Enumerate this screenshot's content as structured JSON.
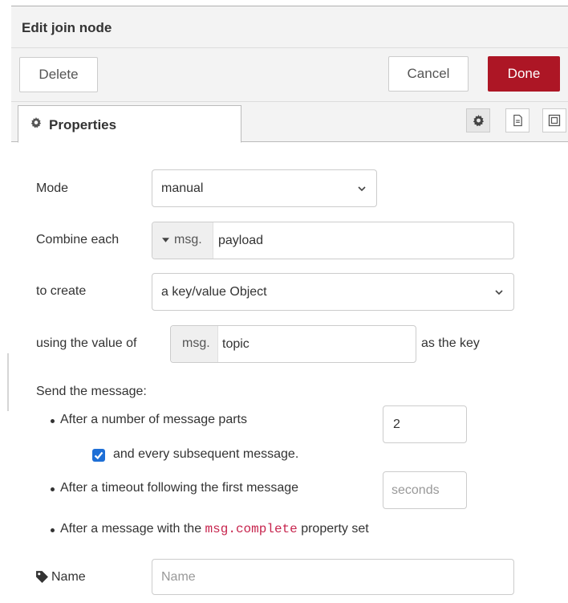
{
  "header": {
    "title": "Edit join node"
  },
  "toolbar": {
    "delete_label": "Delete",
    "cancel_label": "Cancel",
    "done_label": "Done"
  },
  "tabs": {
    "properties_label": "Properties"
  },
  "form": {
    "mode": {
      "label": "Mode",
      "value": "manual"
    },
    "combine": {
      "label": "Combine each",
      "prefix": "msg.",
      "value": "payload"
    },
    "create": {
      "label": "to create",
      "value": "a key/value Object"
    },
    "key": {
      "label": "using the value of",
      "prefix": "msg.",
      "value": "topic",
      "suffix": "as the key"
    },
    "send": {
      "label": "Send the message:",
      "parts_label": "After a number of message parts",
      "parts_value": "2",
      "subsequent_label": "and every subsequent message.",
      "subsequent_checked": true,
      "timeout_label": "After a timeout following the first message",
      "timeout_placeholder": "seconds",
      "complete_prefix": "After a message with the ",
      "complete_code": "msg.complete",
      "complete_suffix": " property set"
    },
    "name": {
      "label": "Name",
      "placeholder": "Name"
    }
  },
  "colors": {
    "done": "#ad1625",
    "checkbox": "#1e6fd6",
    "code": "#c7254e"
  },
  "icons": [
    "gear-icon",
    "file-icon",
    "frame-icon",
    "chevron-down-icon",
    "caret-down-icon",
    "tag-icon",
    "check-icon"
  ]
}
